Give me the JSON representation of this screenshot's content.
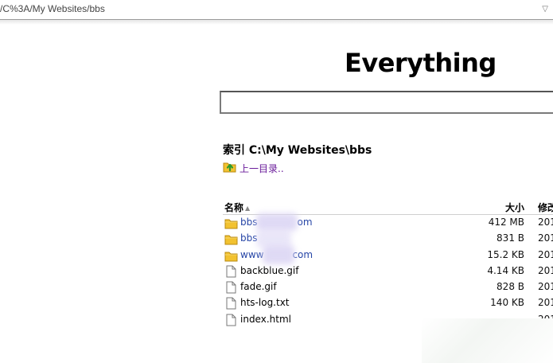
{
  "address_bar": {
    "url": "/C%3A/My Websites/bbs",
    "dropdown_icon": "chevron-down-icon"
  },
  "brand": {
    "title": "Everything"
  },
  "search": {
    "value": "",
    "placeholder": ""
  },
  "index": {
    "title": "索引 C:\\My Websites\\bbs"
  },
  "parent_link": {
    "label": "上一目录..",
    "icon": "folder-up-icon"
  },
  "table": {
    "columns": {
      "name": "名称",
      "size": "大小",
      "modified": "修改"
    },
    "sort_icon": "sort-ascending-icon",
    "rows": [
      {
        "type": "folder",
        "name_start": "bbs",
        "name_end": "om",
        "size": "412 MB",
        "modified": "201"
      },
      {
        "type": "folder",
        "name_start": "bbs",
        "name_end": "",
        "size": "831 B",
        "modified": "201"
      },
      {
        "type": "folder",
        "name_start": "www",
        "name_end": "com",
        "size": "15.2 KB",
        "modified": "201"
      },
      {
        "type": "file",
        "name_start": "backblue.gif",
        "name_end": "",
        "size": "4.14 KB",
        "modified": "201"
      },
      {
        "type": "file",
        "name_start": "fade.gif",
        "name_end": "",
        "size": "828 B",
        "modified": "201"
      },
      {
        "type": "file",
        "name_start": "hts-log.txt",
        "name_end": "",
        "size": "140 KB",
        "modified": "201"
      },
      {
        "type": "file",
        "name_start": "index.html",
        "name_end": "",
        "size": "",
        "modified": "201"
      }
    ]
  },
  "colors": {
    "folder_link": "#2645a6",
    "visited_link": "#6a1b9a",
    "folder_icon": "#f2c230",
    "redaction": "#dcd6f4"
  }
}
